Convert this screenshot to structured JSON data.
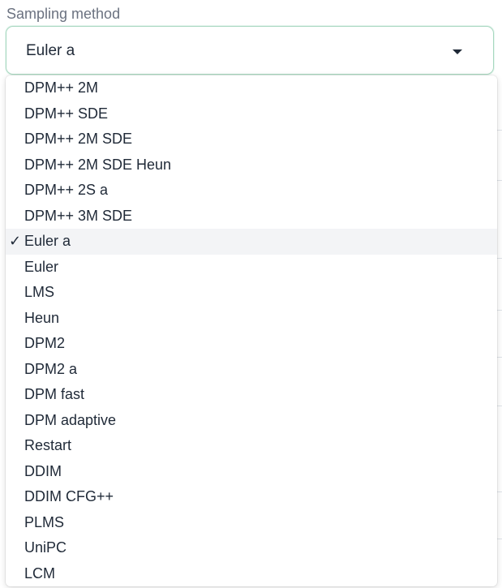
{
  "field": {
    "label": "Sampling method",
    "selected_value": "Euler a"
  },
  "dropdown": {
    "selected_index": 6,
    "options": [
      "DPM++ 2M",
      "DPM++ SDE",
      "DPM++ 2M SDE",
      "DPM++ 2M SDE Heun",
      "DPM++ 2S a",
      "DPM++ 3M SDE",
      "Euler a",
      "Euler",
      "LMS",
      "Heun",
      "DPM2",
      "DPM2 a",
      "DPM fast",
      "DPM adaptive",
      "Restart",
      "DDIM",
      "DDIM CFG++",
      "PLMS",
      "UniPC",
      "LCM"
    ],
    "check_glyph": "✓"
  },
  "colors": {
    "focus_border": "#a8d8c0",
    "text": "#1f2937",
    "label": "#6b7280",
    "selected_bg": "#f3f4f6"
  }
}
